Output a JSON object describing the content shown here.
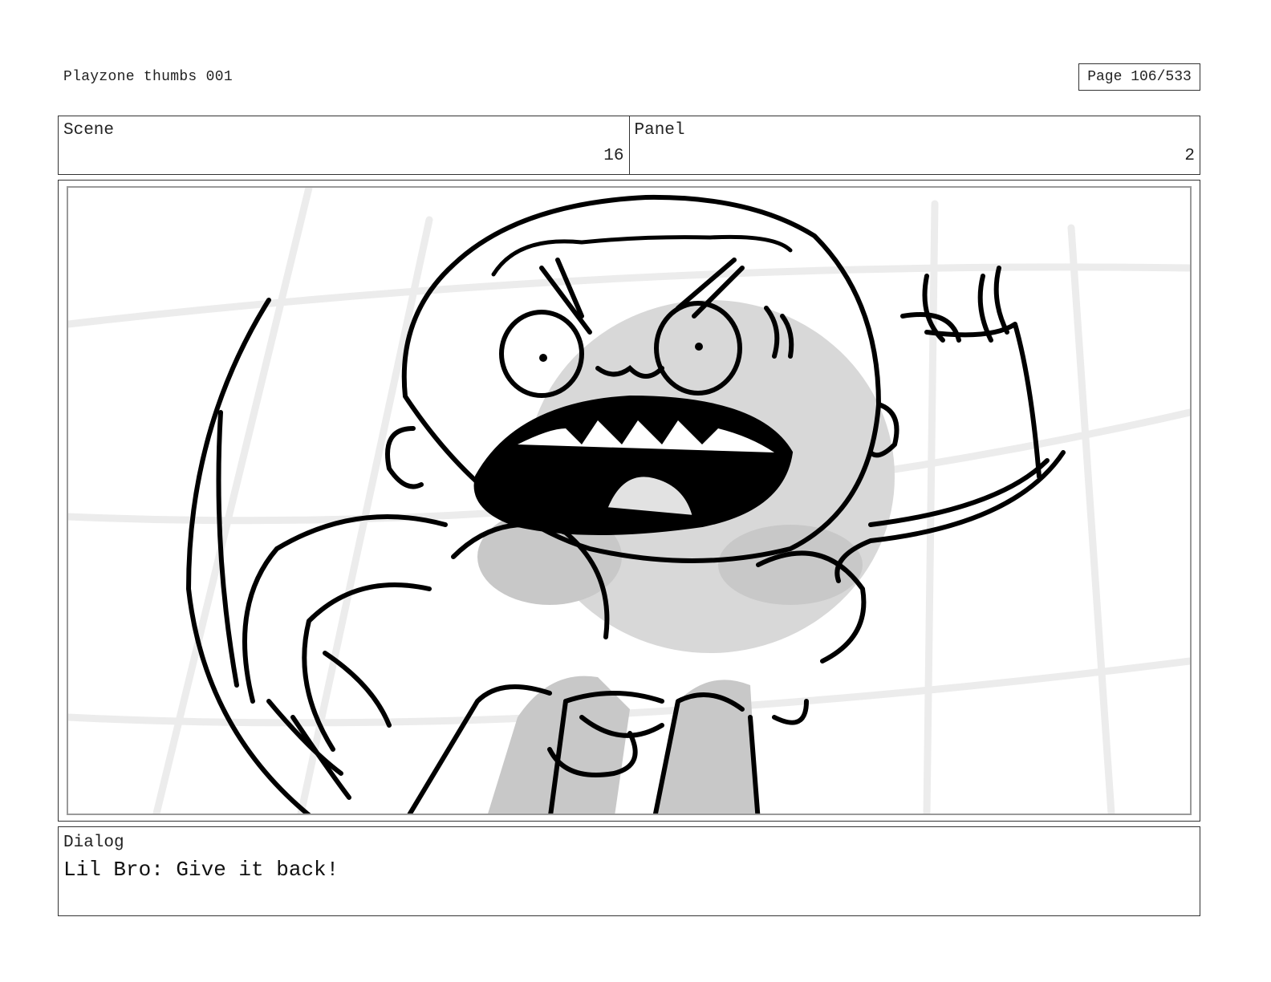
{
  "document": {
    "title": "Playzone thumbs 001",
    "page_indicator": "Page 106/533"
  },
  "header": {
    "scene_label": "Scene",
    "scene_value": "16",
    "panel_label": "Panel",
    "panel_value": "2"
  },
  "dialog": {
    "label": "Dialog",
    "text": "Lil Bro: Give it back!"
  },
  "colors": {
    "ink": "#000000",
    "shade": "#c8c8c8",
    "light_shade": "#e2e2e2",
    "background_lines": "#ececec",
    "border": "#333333"
  }
}
